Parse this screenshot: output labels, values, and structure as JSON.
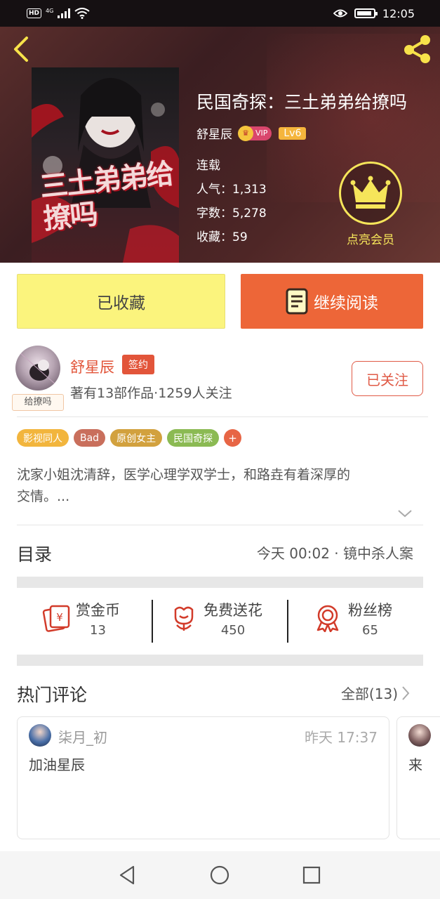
{
  "status_bar": {
    "indicators": [
      "HD",
      "4G"
    ],
    "time": "12:05",
    "icons": [
      "hd-icon",
      "signal-icon",
      "wifi-icon",
      "eye-comfort-icon",
      "battery-icon"
    ]
  },
  "header": {
    "back_icon": "chevron-left-icon",
    "share_icon": "share-icon"
  },
  "book": {
    "title": "民国奇探：三土弟弟给撩吗",
    "cover_title": "三土弟弟给撩吗",
    "author": "舒星辰",
    "vip_label": "VIP",
    "level": "Lv6",
    "status": "连载",
    "popularity": "人气：1,313",
    "word_count": "字数：5,278",
    "favorites": "收藏：59"
  },
  "membership": {
    "label": "点亮会员",
    "icon": "crown-icon",
    "color": "#f6e55a"
  },
  "actions": {
    "collected_label": "已收藏",
    "continue_label": "继续阅读",
    "collected_color": "#fbf47d",
    "continue_color": "#ed6638"
  },
  "author_card": {
    "name": "舒星辰",
    "avatar_tag": "给撩吗",
    "signed_label": "签约",
    "stats": "著有13部作品·1259人关注",
    "follow_label": "已关注"
  },
  "tags": [
    {
      "label": "影视同人",
      "color": "#f2b53d"
    },
    {
      "label": "Bad",
      "color": "#c96f5c"
    },
    {
      "label": "原创女主",
      "color": "#d2a13e"
    },
    {
      "label": "民国奇探",
      "color": "#8bba53"
    }
  ],
  "tag_add": "+",
  "synopsis": {
    "line1": "沈家小姐沈清辞，医学心理学双学士，和路垚有着深厚的",
    "line2": "交情。..."
  },
  "toc": {
    "label": "目录",
    "latest": "今天 00:02 · 镜中杀人案"
  },
  "stats": [
    {
      "label": "赏金币",
      "value": "13",
      "icon": "reward-coin-icon"
    },
    {
      "label": "免费送花",
      "value": "450",
      "icon": "flower-icon"
    },
    {
      "label": "粉丝榜",
      "value": "65",
      "icon": "medal-icon"
    }
  ],
  "hot_comments": {
    "label": "热门评论",
    "all_label": "全部(13)",
    "items": [
      {
        "user": "柒月_初",
        "time": "昨天 17:37",
        "text": "加油星辰"
      },
      {
        "text": "来"
      }
    ]
  },
  "nav_bar": {
    "icons": [
      "back-triangle-icon",
      "home-circle-icon",
      "recents-square-icon"
    ]
  }
}
